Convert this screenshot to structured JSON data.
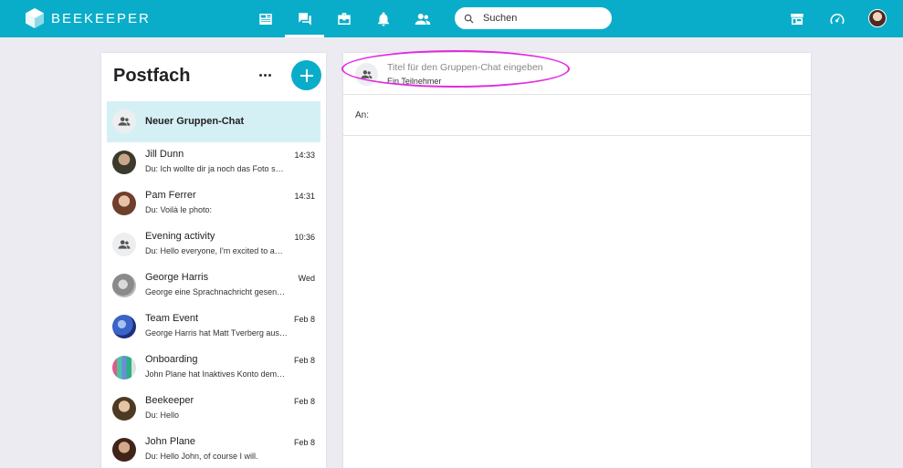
{
  "app": {
    "name": "BEEKEEPER",
    "accent": "#0aadc9",
    "selected_row": "#d4f0f5",
    "highlight_color": "#e12be0"
  },
  "nav": [
    {
      "name": "stream-icon",
      "active": false
    },
    {
      "name": "chat-icon",
      "active": true
    },
    {
      "name": "tools-icon",
      "active": false
    },
    {
      "name": "bell-icon",
      "active": false
    },
    {
      "name": "people-icon",
      "active": false
    }
  ],
  "search": {
    "placeholder": "Suchen"
  },
  "inbox": {
    "title": "Postfach",
    "conversations": [
      {
        "name": "Neuer Gruppen-Chat",
        "time": "",
        "preview": "",
        "avatar": "group",
        "selected": true
      },
      {
        "name": "Jill Dunn",
        "time": "14:33",
        "preview": "Du: Ich wollte dir ja noch das Foto s…",
        "avatar": "photo"
      },
      {
        "name": "Pam Ferrer",
        "time": "14:31",
        "preview": "Du: Voilà le photo:",
        "avatar": "photo"
      },
      {
        "name": "Evening activity",
        "time": "10:36",
        "preview": "Du: Hello everyone, I'm excited to a…",
        "avatar": "group"
      },
      {
        "name": "George Harris",
        "time": "Wed",
        "preview": "George eine Sprachnachricht gesen…",
        "avatar": "photo"
      },
      {
        "name": "Team Event",
        "time": "Feb 8",
        "preview": "George Harris hat Matt Tverberg aus…",
        "avatar": "photo"
      },
      {
        "name": "Onboarding",
        "time": "Feb 8",
        "preview": "John Plane hat Inaktives Konto dem…",
        "avatar": "photo"
      },
      {
        "name": "Beekeeper",
        "time": "Feb 8",
        "preview": "Du: Hello",
        "avatar": "photo"
      },
      {
        "name": "John Plane",
        "time": "Feb 8",
        "preview": "Du: Hello John, of course I will.",
        "avatar": "photo"
      }
    ]
  },
  "chat": {
    "title_placeholder": "Titel für den Gruppen-Chat eingeben",
    "members": "Ein Teilnehmer",
    "to_label": "An:"
  }
}
